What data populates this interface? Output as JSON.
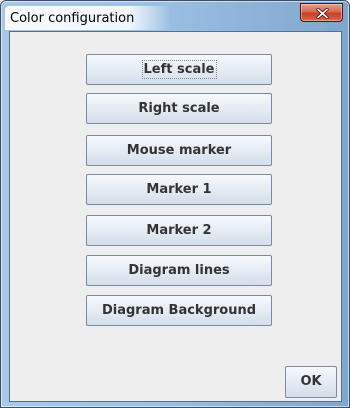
{
  "window": {
    "title": "Color configuration",
    "close_icon": "close-icon"
  },
  "buttons": [
    {
      "label": "Left scale"
    },
    {
      "label": "Right scale"
    },
    {
      "label": "Mouse marker"
    },
    {
      "label": "Marker 1"
    },
    {
      "label": "Marker 2"
    },
    {
      "label": "Diagram lines"
    },
    {
      "label": "Diagram Background"
    }
  ],
  "footer": {
    "ok_label": "OK"
  }
}
